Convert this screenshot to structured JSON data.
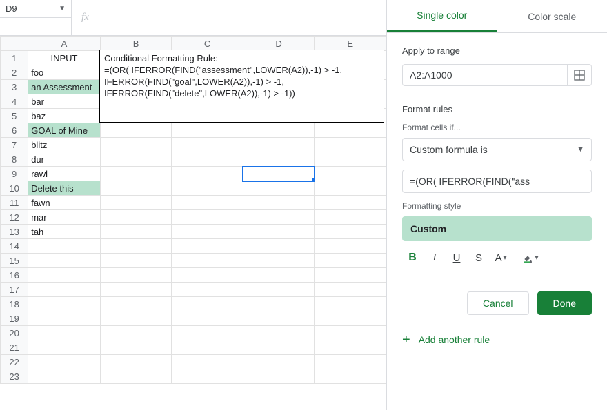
{
  "name_box": "D9",
  "grid": {
    "columns": [
      "A",
      "B",
      "C",
      "D",
      "E"
    ],
    "rows": [
      "1",
      "2",
      "3",
      "4",
      "5",
      "6",
      "7",
      "8",
      "9",
      "10",
      "11",
      "12",
      "13",
      "14",
      "15",
      "16",
      "17",
      "18",
      "19",
      "20",
      "21",
      "22",
      "23"
    ],
    "colA": {
      "header": "INPUT",
      "values": [
        "foo",
        "an Assessment",
        "bar",
        "baz",
        "GOAL of Mine",
        "blitz",
        "dur",
        "rawl",
        "Delete this",
        "fawn",
        "mar",
        "tah"
      ]
    },
    "highlighted_rows": [
      "an Assessment",
      "GOAL of Mine",
      "Delete this"
    ]
  },
  "annotation": "Conditional Formatting Rule:\n=(OR( IFERROR(FIND(\"assessment\",LOWER(A2)),-1) > -1,\nIFERROR(FIND(\"goal\",LOWER(A2)),-1) > -1,\nIFERROR(FIND(\"delete\",LOWER(A2)),-1) > -1))",
  "side": {
    "tabs": {
      "single": "Single color",
      "scale": "Color scale"
    },
    "apply_label": "Apply to range",
    "range_value": "A2:A1000",
    "rules_label": "Format rules",
    "cells_if_label": "Format cells if...",
    "condition": "Custom formula is",
    "formula_value": "=(OR( IFERROR(FIND(\"ass",
    "style_label": "Formatting style",
    "style_preview": "Custom",
    "cancel": "Cancel",
    "done": "Done",
    "add_rule": "Add another rule"
  }
}
